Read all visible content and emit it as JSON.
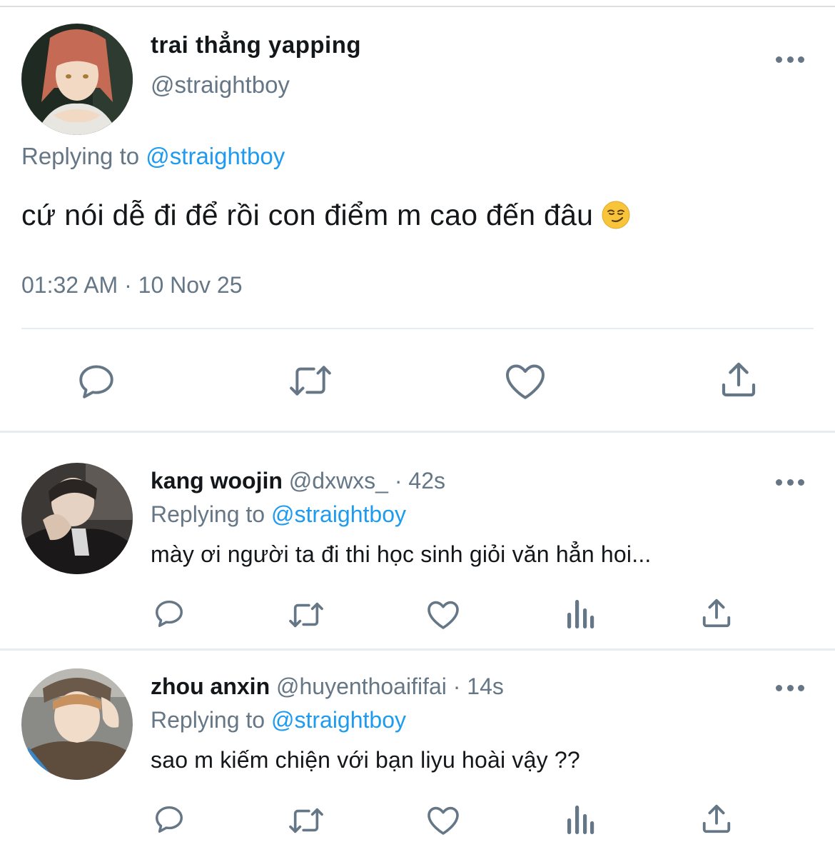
{
  "main_tweet": {
    "display_name": "trai thẳng yapping",
    "handle": "@straightboy",
    "replying_prefix": "Replying to",
    "replying_handle": "@straightboy",
    "text": "cứ nói dễ đi để rồi con điểm m cao đến đâu",
    "emoji": "smirking-face",
    "timestamp": "01:32 AM · 10 Nov 25",
    "actions": [
      "reply-icon",
      "retweet-icon",
      "like-icon",
      "share-icon"
    ]
  },
  "replies": [
    {
      "display_name": "kang woojin",
      "meta": "@dxwxs_ · 42s",
      "replying_prefix": "Replying to",
      "replying_handle": "@straightboy",
      "text": "mày ơi người ta đi thi học sinh giỏi văn hẳn hoi..."
    },
    {
      "display_name": "zhou anxin",
      "meta": "@huyenthoaififai · 14s",
      "replying_prefix": "Replying to",
      "replying_handle": "@straightboy",
      "text": "sao m kiếm chiện với bạn liyu hoài vậy ??"
    }
  ],
  "colors": {
    "text": "#14171a",
    "secondary": "#657786",
    "link": "#1d9bf0",
    "divider": "#e6ecf0"
  }
}
